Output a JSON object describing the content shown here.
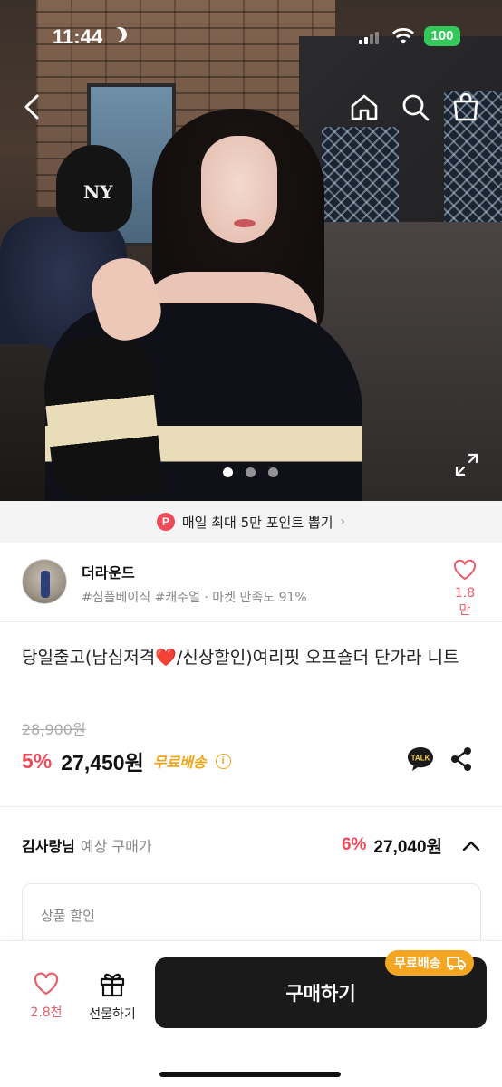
{
  "status_bar": {
    "time": "11:44",
    "battery": "100"
  },
  "promo": {
    "badge": "P",
    "text": "매일 최대 5만 포인트 뽑기"
  },
  "seller": {
    "name": "더라운드",
    "tags": "#심플베이직 #캐주얼 · 마켓 만족도 91%",
    "likes": "1.8만"
  },
  "product": {
    "title": "당일출고(남심저격❤️/신상할인)여리핏 오프숄더 단가라 니트",
    "original_price": "28,900원",
    "discount": "5%",
    "price": "27,450원",
    "shipping": "무료배송",
    "info_icon": "i",
    "talk_label": "TALK"
  },
  "expected": {
    "name": "김사랑님",
    "label": "예상 구매가",
    "discount": "6%",
    "price": "27,040원"
  },
  "discount_box": {
    "label": "상품 할인"
  },
  "bottom_bar": {
    "likes": "2.8천",
    "gift_label": "선물하기",
    "buy_label": "구매하기",
    "free_tag": "무료배송"
  },
  "colors": {
    "accent_red": "#ef4a5a",
    "shipping_yellow": "#f4a623",
    "buy_button": "#1a1a1a",
    "battery_green": "#34c759"
  },
  "icons": [
    "back-icon",
    "home-icon",
    "search-icon",
    "cart-icon",
    "expand-icon",
    "heart-icon",
    "talk-icon",
    "share-icon",
    "chevron-up-icon",
    "gift-icon",
    "truck-icon"
  ]
}
